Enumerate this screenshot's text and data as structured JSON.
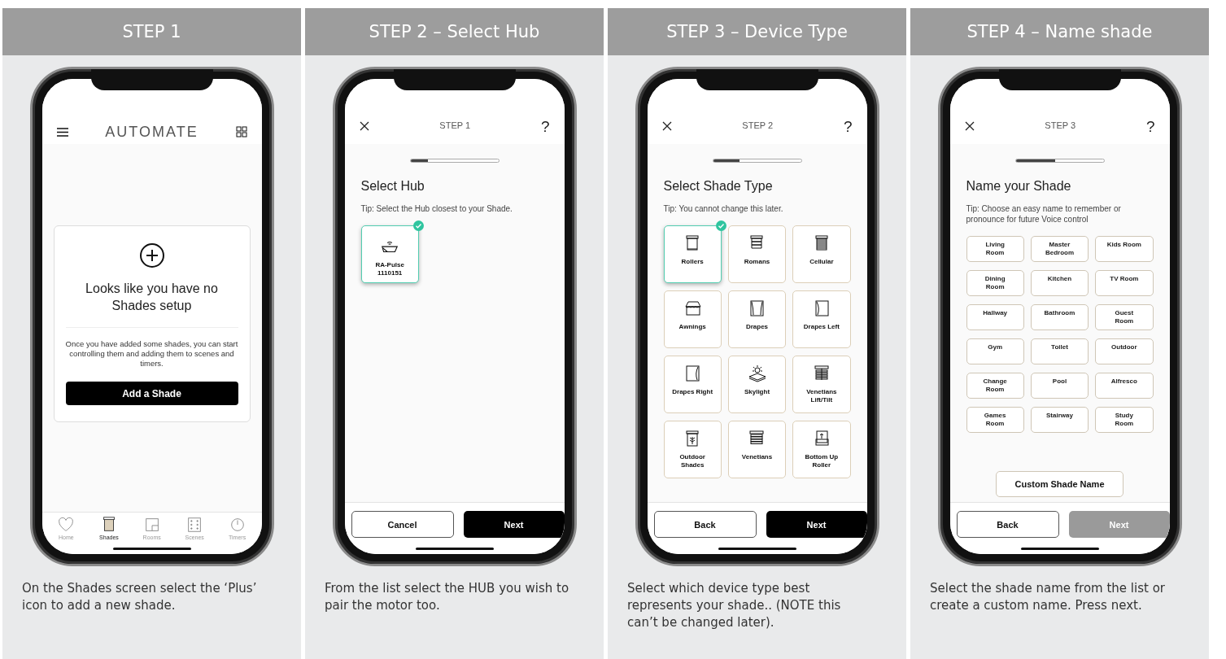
{
  "steps": [
    {
      "header": "STEP 1",
      "caption": "On the Shades screen select the ‘Plus’ icon to add a new shade.",
      "screen": {
        "kind": "home",
        "logo": "AUTOMATE",
        "empty_title": "Looks like you have no Shades setup",
        "empty_text": "Once you have added some shades, you can start controlling them and adding them to scenes and timers.",
        "action": "Add a Shade",
        "nav": [
          {
            "label": "Home",
            "selected": false
          },
          {
            "label": "Shades",
            "selected": true
          },
          {
            "label": "Rooms",
            "selected": false
          },
          {
            "label": "Scenes",
            "selected": false
          },
          {
            "label": "Timers",
            "selected": false
          }
        ]
      }
    },
    {
      "header": "STEP 2 – Select Hub",
      "caption": "From the list select the HUB you wish to pair the motor too.",
      "screen": {
        "kind": "hub",
        "step": "STEP 1",
        "help": "?",
        "level": 0.2,
        "title": "Select Hub",
        "tip": "Tip: Select the Hub closest to your Shade.",
        "tiles": [
          {
            "label": "RA-Pulse\n1110151",
            "selected": true
          }
        ],
        "buttons": [
          {
            "label": "Cancel",
            "kind": "outline",
            "disabled": false
          },
          {
            "label": "Next",
            "kind": "solid",
            "disabled": false
          }
        ]
      }
    },
    {
      "header": "STEP 3 – Device Type",
      "caption": "Select which device type best represents your shade.. (NOTE this can’t be changed later).",
      "screen": {
        "kind": "shade_type",
        "step": "STEP 2",
        "help": "?",
        "level": 0.3,
        "title": "Select Shade Type",
        "tip": "Tip: You cannot change this later.",
        "tiles": [
          {
            "label": "Rollers",
            "selected": true
          },
          {
            "label": "Romans",
            "selected": false
          },
          {
            "label": "Cellular",
            "selected": false
          },
          {
            "label": "Awnings",
            "selected": false
          },
          {
            "label": "Drapes",
            "selected": false
          },
          {
            "label": "Drapes Left",
            "selected": false
          },
          {
            "label": "Drapes Right",
            "selected": false
          },
          {
            "label": "Skylight",
            "selected": false
          },
          {
            "label": "Venetians\nLift/Tilt",
            "selected": false
          },
          {
            "label": "Outdoor\nShades",
            "selected": false
          },
          {
            "label": "Venetians",
            "selected": false
          },
          {
            "label": "Bottom Up\nRoller",
            "selected": false
          }
        ],
        "buttons": [
          {
            "label": "Back",
            "kind": "outline",
            "disabled": false
          },
          {
            "label": "Next",
            "kind": "solid",
            "disabled": false
          }
        ]
      }
    },
    {
      "header": "STEP 4 – Name shade",
      "caption": "Select the shade name from the list or create a custom name. Press next.",
      "screen": {
        "kind": "name",
        "step": "STEP 3",
        "help": "?",
        "level": 0.45,
        "title": "Name your Shade",
        "tip": "Tip: Choose an easy name to remember or pronounce for future Voice control",
        "names": [
          "Living\nRoom",
          "Master\nBedroom",
          "Kids Room",
          "Dining\nRoom",
          "Kitchen",
          "TV Room",
          "Hallway",
          "Bathroom",
          "Guest\nRoom",
          "Gym",
          "Toilet",
          "Outdoor",
          "Change\nRoom",
          "Pool",
          "Alfresco",
          "Games\nRoom",
          "Stairway",
          "Study\nRoom"
        ],
        "custom": "Custom Shade Name",
        "buttons": [
          {
            "label": "Back",
            "kind": "outline",
            "disabled": false
          },
          {
            "label": "Next",
            "kind": "solid",
            "disabled": true
          }
        ]
      }
    }
  ]
}
